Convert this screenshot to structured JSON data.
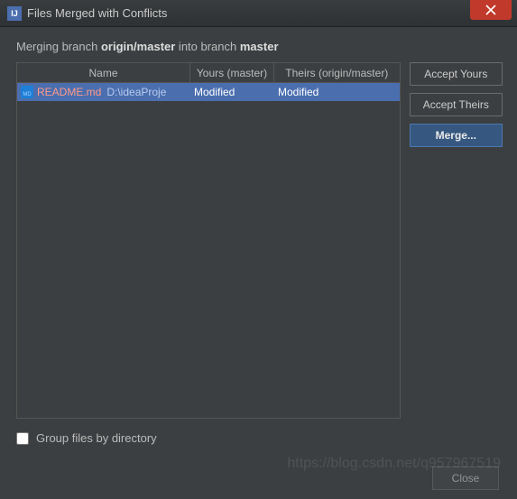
{
  "window": {
    "title": "Files Merged with Conflicts",
    "app_icon_label": "IJ"
  },
  "desc": {
    "prefix": "Merging branch ",
    "from_branch": "origin/master",
    "mid": " into branch ",
    "to_branch": "master"
  },
  "table": {
    "headers": {
      "name": "Name",
      "yours": "Yours (master)",
      "theirs": "Theirs (origin/master)"
    },
    "rows": [
      {
        "icon_text": "MD",
        "filename": "README.md",
        "path": "D:\\ideaProje",
        "yours": "Modified",
        "theirs": "Modified"
      }
    ]
  },
  "buttons": {
    "accept_yours": "Accept Yours",
    "accept_theirs": "Accept Theirs",
    "merge": "Merge...",
    "close": "Close"
  },
  "checkbox": {
    "group_label": "Group files by directory",
    "checked": false
  },
  "watermark": "https://blog.csdn.net/q957967519"
}
